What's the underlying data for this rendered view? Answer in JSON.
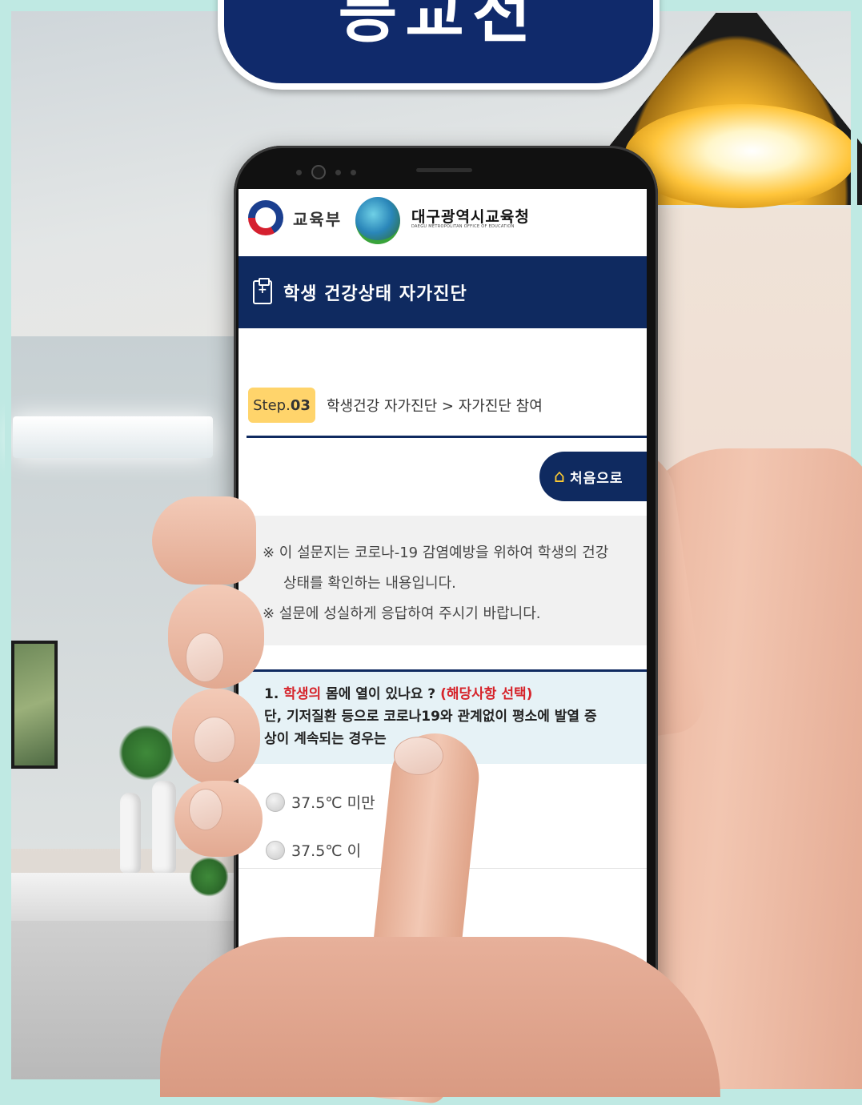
{
  "banner": {
    "text": "등교전"
  },
  "logos": {
    "gov_label": "교육부",
    "edu_name": "대구광역시교육청",
    "edu_sub": "DAEGU METROPOLITAN OFFICE OF EDUCATION"
  },
  "header": {
    "title": "학생 건강상태 자가진단"
  },
  "step": {
    "prefix": "Step.",
    "number": "03",
    "path": "학생건강 자가진단 > 자가진단 참여"
  },
  "home_button": {
    "label": "처음으로",
    "icon": "home-icon"
  },
  "notice": {
    "line1": "※ 이 설문지는 코로나-19 감염예방을 위하여 학생의 건강",
    "line2": "상태를 확인하는 내용입니다.",
    "line3": "※ 설문에 성실하게 응답하여 주시기 바랍니다."
  },
  "question": {
    "number": "1.",
    "subject": "학생의",
    "text": "몸에 열이 있나요 ?",
    "hint": "(해당사항 선택)",
    "line2": "단, 기저질환 등으로 코로나19와 관계없이 평소에 발열 증",
    "line3": "상이 계속되는 경우는"
  },
  "options": [
    {
      "label": "37.5℃ 미만"
    },
    {
      "label": "37.5℃ 이"
    }
  ],
  "colors": {
    "navy": "#0f2a60",
    "step_badge": "#ffd46b",
    "red": "#d6242b",
    "frame": "#bfe9e3"
  }
}
